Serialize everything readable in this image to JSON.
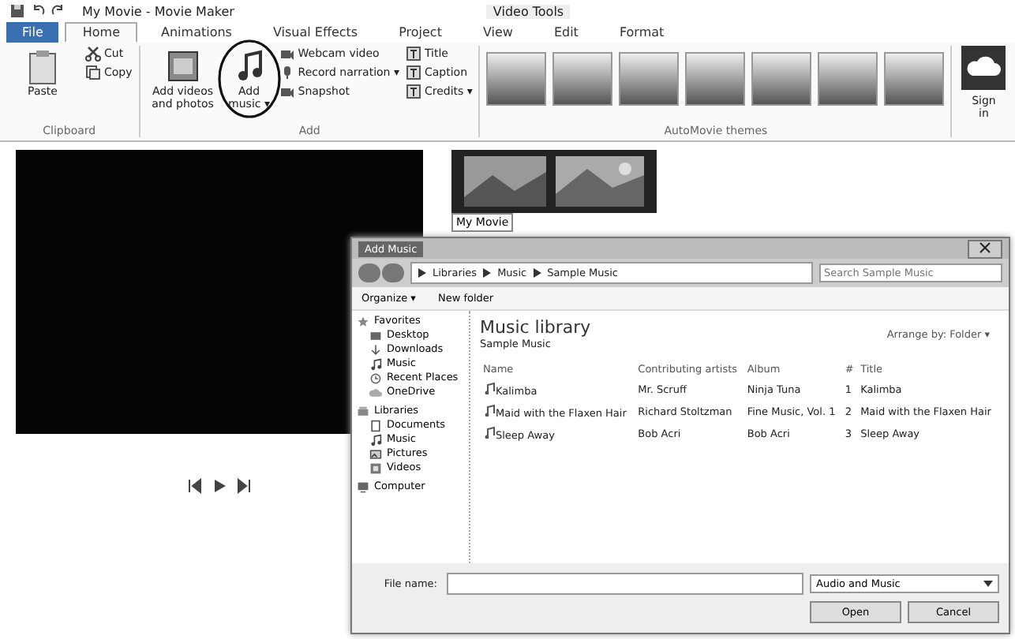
{
  "window": {
    "title": "My Movie - Movie Maker",
    "context_tab_group": "Video Tools"
  },
  "tabs": [
    {
      "label": "File",
      "selected": false,
      "kind": "file"
    },
    {
      "label": "Home",
      "selected": true,
      "kind": "tab"
    },
    {
      "label": "Animations",
      "selected": false,
      "kind": "tab"
    },
    {
      "label": "Visual Effects",
      "selected": false,
      "kind": "tab"
    },
    {
      "label": "Project",
      "selected": false,
      "kind": "tab"
    },
    {
      "label": "View",
      "selected": false,
      "kind": "tab"
    },
    {
      "label": "Edit",
      "selected": false,
      "kind": "tab"
    },
    {
      "label": "Format",
      "selected": false,
      "kind": "tab"
    }
  ],
  "ribbon": {
    "groups": [
      {
        "label": "Clipboard",
        "large": [
          "Paste"
        ],
        "small": [
          "Cut",
          "Copy"
        ]
      },
      {
        "label": "Add",
        "large": [
          "Add videos and photos",
          "Add music ▾"
        ],
        "small": [
          "Webcam video",
          "Record narration ▾",
          "Snapshot"
        ],
        "small2": [
          "Title",
          "Caption",
          "Credits ▾"
        ]
      },
      {
        "label": "AutoMovie themes",
        "kind": "themes"
      }
    ],
    "sign_in": "Sign in"
  },
  "storyboard": {
    "clip_label": "My Movie"
  },
  "dialog": {
    "title": "Add Music",
    "path": [
      "Libraries",
      "Music",
      "Sample Music"
    ],
    "search": {
      "placeholder": "Search Sample Music"
    },
    "toolbar": [
      "Organize ▾",
      "New folder"
    ],
    "nav": [
      {
        "label": "Favorites",
        "children": [
          "Desktop",
          "Downloads",
          "Music",
          "Recent Places",
          "OneDrive"
        ]
      },
      {
        "label": "Libraries",
        "children": [
          "Documents",
          "Music",
          "Pictures",
          "Videos"
        ]
      },
      {
        "label": "Computer"
      }
    ],
    "library_title": "Music library",
    "library_subtitle": "Sample Music",
    "arrange": "Arrange by:  Folder ▾",
    "columns": [
      "Name",
      "Contributing artists",
      "Album",
      "#",
      "Title"
    ],
    "rows": [
      [
        "Kalimba",
        "Mr. Scruff",
        "Ninja Tuna",
        "1",
        "Kalimba"
      ],
      [
        "Maid with the Flaxen Hair",
        "Richard Stoltzman",
        "Fine Music, Vol. 1",
        "2",
        "Maid with the Flaxen Hair"
      ],
      [
        "Sleep Away",
        "Bob Acri",
        "Bob Acri",
        "3",
        "Sleep Away"
      ]
    ],
    "file_name_label": "File name:",
    "file_type": "Audio and Music",
    "buttons": [
      "Open",
      "Cancel"
    ]
  }
}
